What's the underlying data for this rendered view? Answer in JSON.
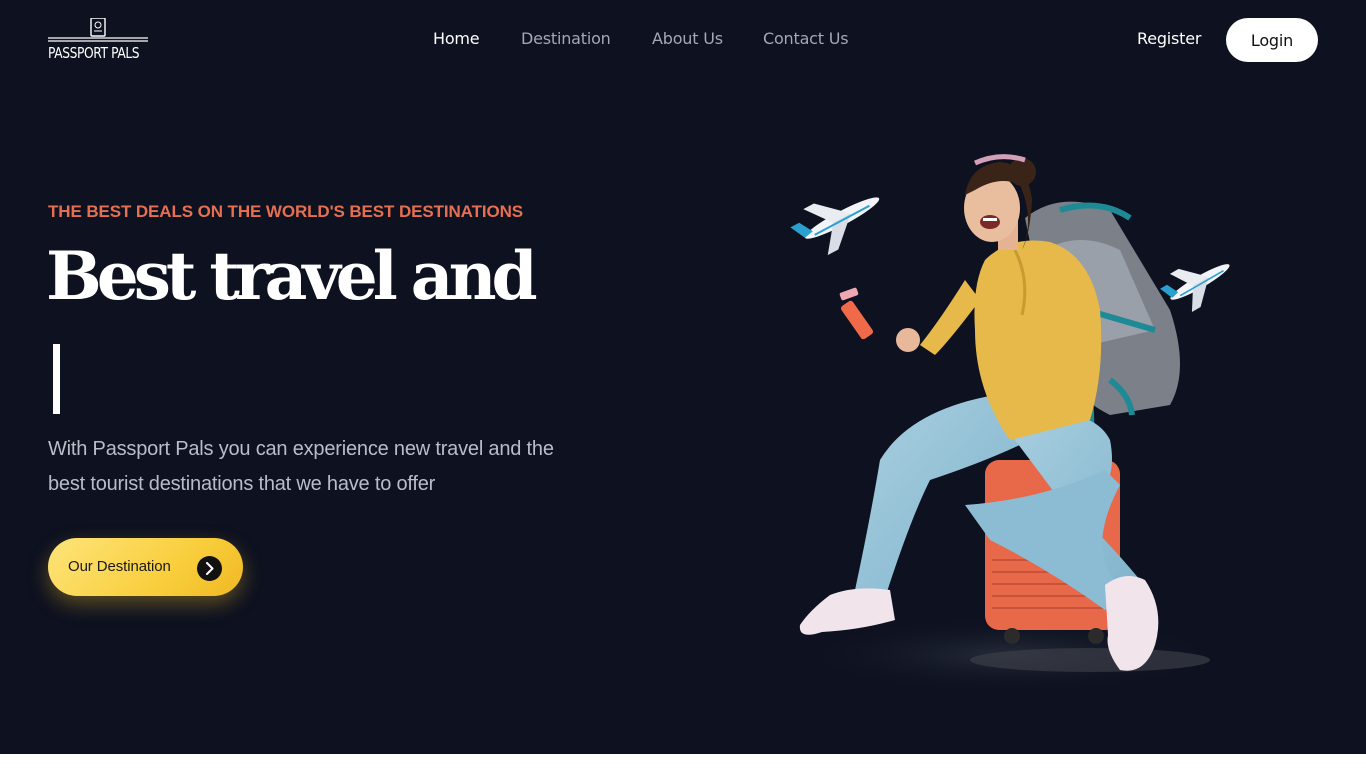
{
  "brand": {
    "name": "PASSPORT PALS"
  },
  "nav": {
    "items": [
      {
        "label": "Home",
        "active": true
      },
      {
        "label": "Destination",
        "active": false
      },
      {
        "label": "About Us",
        "active": false
      },
      {
        "label": "Contact Us",
        "active": false
      }
    ],
    "register_label": "Register",
    "login_label": "Login"
  },
  "hero": {
    "eyebrow": "THE BEST DEALS ON THE WORLD'S BEST DESTINATIONS",
    "headline": "Best travel and",
    "description": "With Passport Pals you can experience new travel and the best tourist destinations that we have to offer",
    "cta_label": "Our Destination",
    "cta_icon": "chevron-right-icon"
  },
  "colors": {
    "background": "#0d1120",
    "accent": "#e76f51",
    "cta": "#f9cf3e",
    "text_muted": "#b9bdc8"
  }
}
